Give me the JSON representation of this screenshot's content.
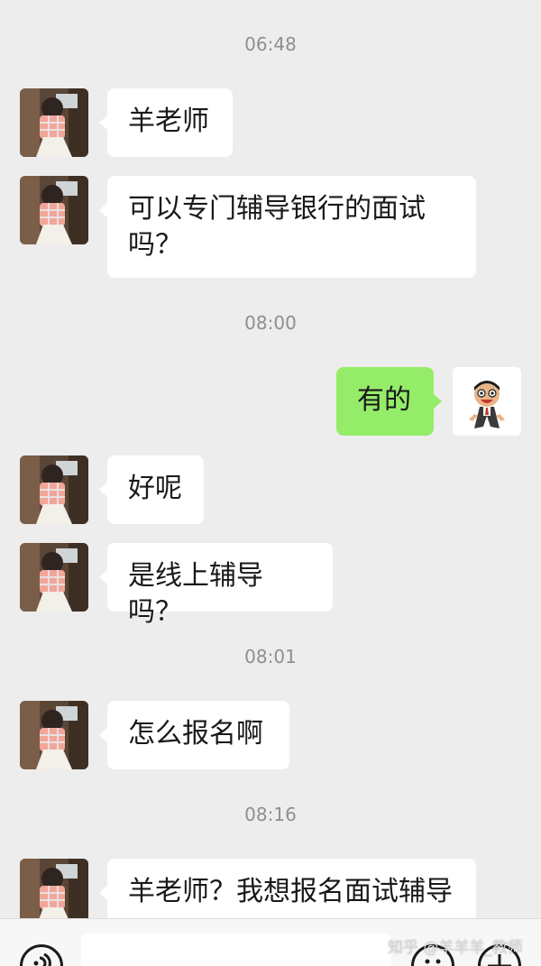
{
  "colors": {
    "background": "#ededed",
    "incoming_bubble": "#ffffff",
    "outgoing_bubble": "#95ec69",
    "timestamp_text": "#8f8f8f"
  },
  "chat": {
    "timestamps": [
      "06:48",
      "08:00",
      "08:01",
      "08:16"
    ],
    "messages": [
      {
        "side": "left",
        "text": "羊老师"
      },
      {
        "side": "left",
        "text": "可以专门辅导银行的面试吗？"
      },
      {
        "side": "right",
        "text": "有的"
      },
      {
        "side": "left",
        "text": "好呢"
      },
      {
        "side": "left",
        "text": "是线上辅导吗？"
      },
      {
        "side": "left",
        "text": "怎么报名啊"
      },
      {
        "side": "left",
        "text": "羊老师？我想报名面试辅导"
      }
    ]
  },
  "input_bar": {
    "voice_icon": "voice-icon",
    "emoji_icon": "emoji-icon",
    "more_icon": "plus-icon"
  },
  "watermark": "知乎 @羊羊羊_教师"
}
